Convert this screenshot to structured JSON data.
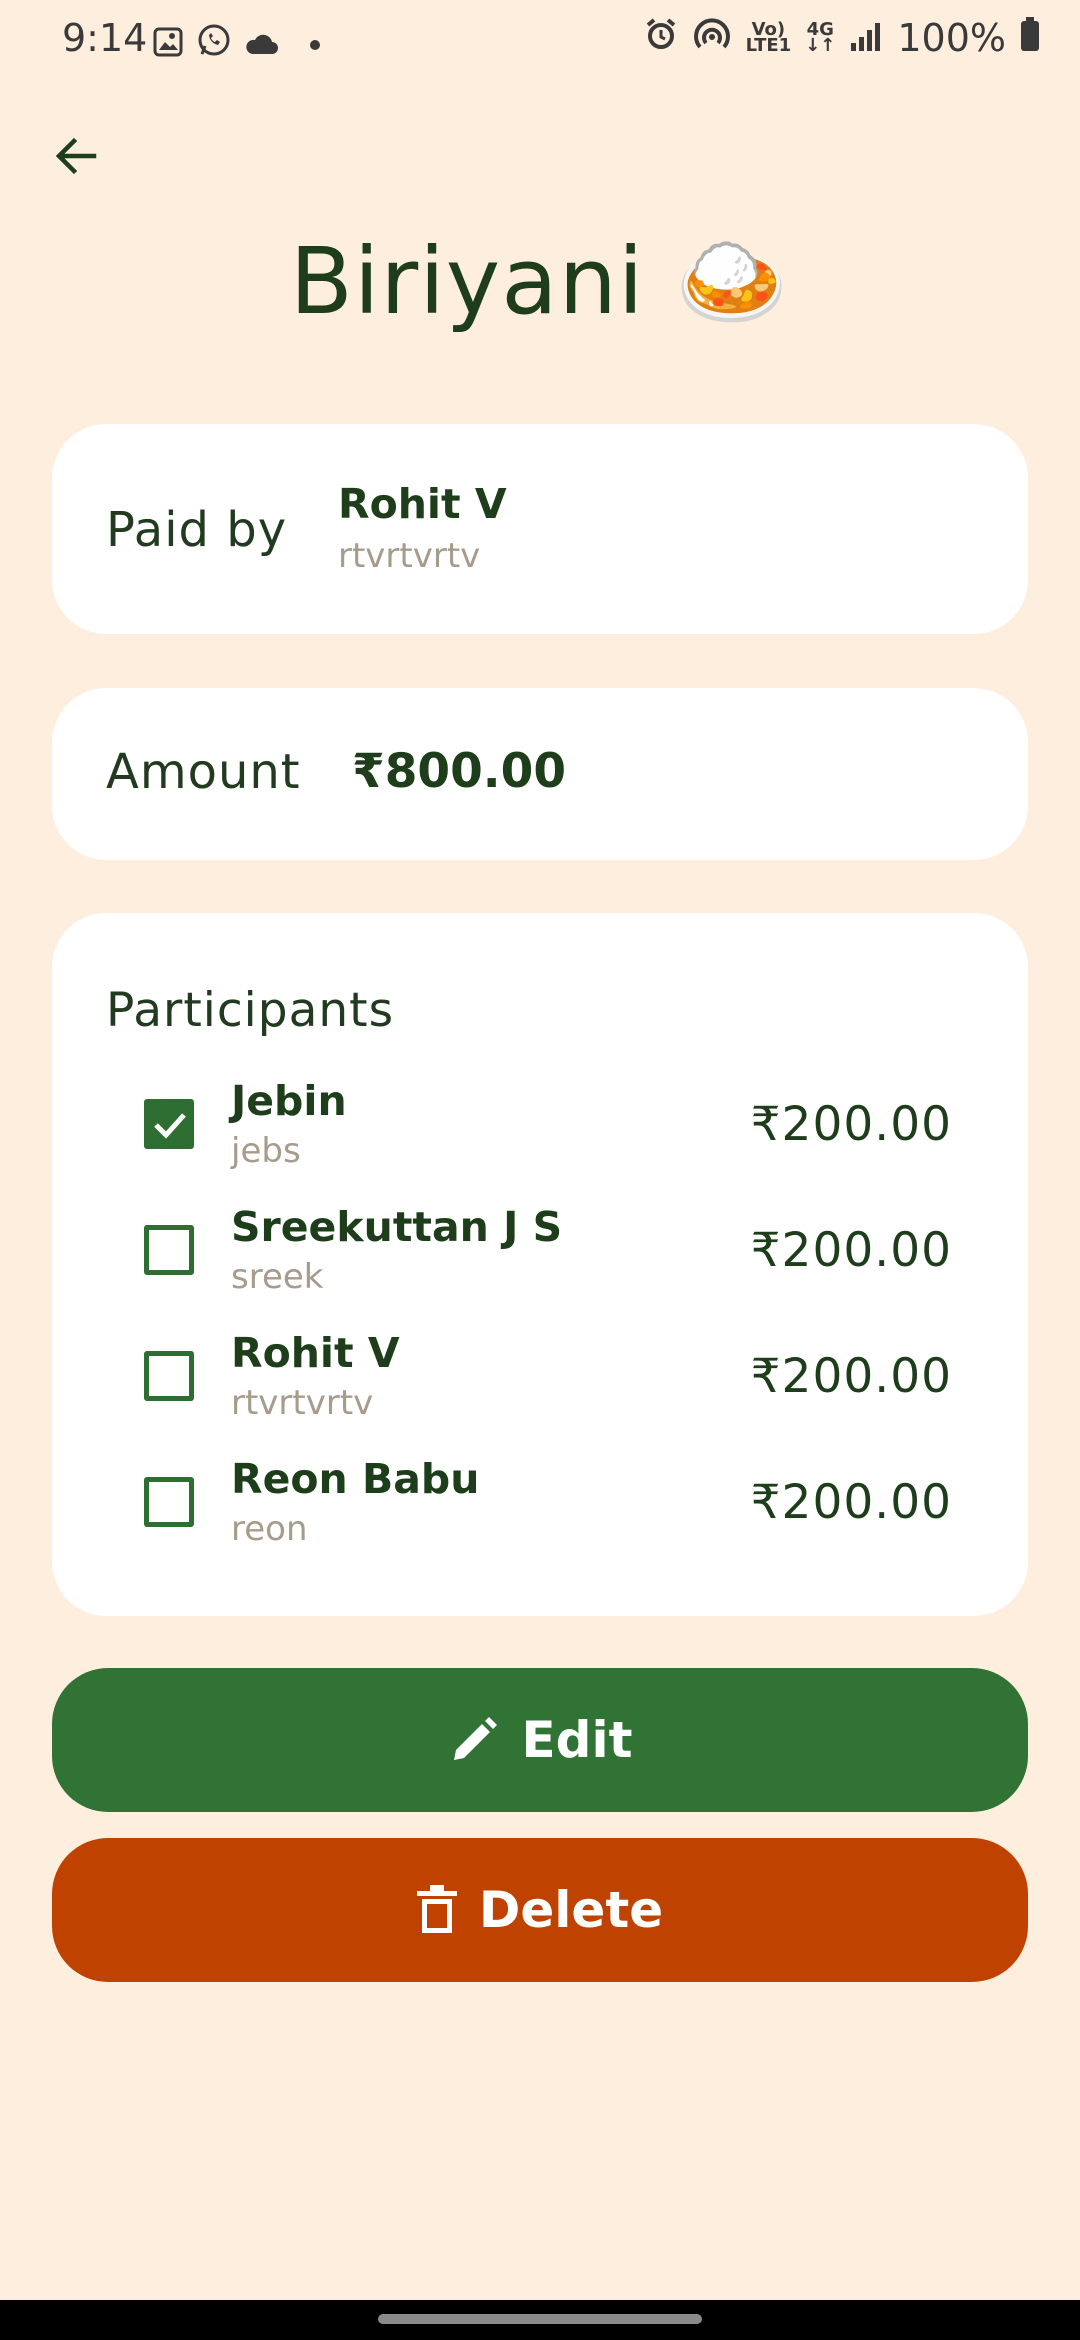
{
  "status_bar": {
    "time": "9:14",
    "left_icons": [
      "gallery-icon",
      "whatsapp-icon",
      "cloud-icon",
      "dot-icon"
    ],
    "volte_label": "Vo)\nLTE1",
    "network_label": "4G",
    "battery": "100%"
  },
  "header": {
    "title": "Biriyani 🍛"
  },
  "paid_by": {
    "label": "Paid by",
    "name": "Rohit V",
    "username": "rtvrtvrtv"
  },
  "amount": {
    "label": "Amount",
    "value": "₹800.00"
  },
  "participants": {
    "title": "Participants",
    "items": [
      {
        "name": "Jebin",
        "username": "jebs",
        "share": "₹200.00",
        "checked": true
      },
      {
        "name": "Sreekuttan J S",
        "username": "sreek",
        "share": "₹200.00",
        "checked": false
      },
      {
        "name": "Rohit V",
        "username": "rtvrtvrtv",
        "share": "₹200.00",
        "checked": false
      },
      {
        "name": "Reon Babu",
        "username": "reon",
        "share": "₹200.00",
        "checked": false
      }
    ]
  },
  "actions": {
    "edit_label": "Edit",
    "delete_label": "Delete"
  },
  "colors": {
    "background": "#fdeedd",
    "primary": "#307334",
    "danger": "#bf4200",
    "text_dark": "#1e3d1b",
    "text_muted": "#a79b8c"
  }
}
